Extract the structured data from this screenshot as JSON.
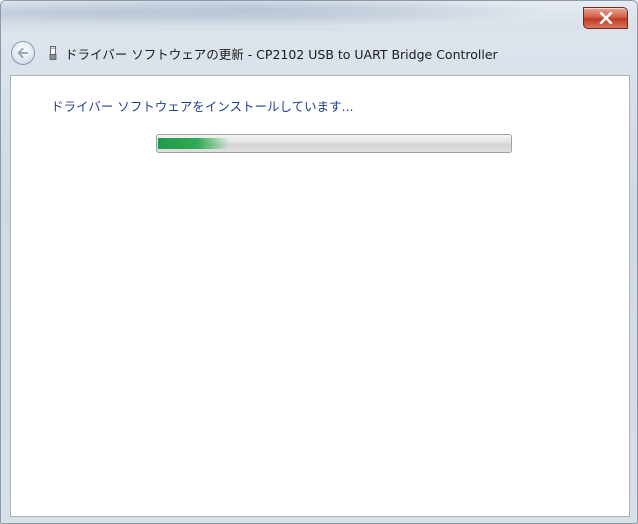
{
  "window": {
    "title": "ドライバー ソフトウェアの更新 - CP2102 USB to UART Bridge Controller"
  },
  "titlebar": {
    "close_icon": "close-icon",
    "back_icon": "back-arrow-icon",
    "driver_icon": "usb-device-icon"
  },
  "content": {
    "status_heading": "ドライバー ソフトウェアをインストールしています...",
    "progress": {
      "value_percent": 20,
      "style": "marquee",
      "color": "#22994a"
    }
  },
  "colors": {
    "heading_text": "#1f3f8f",
    "close_button": "#c0391f"
  }
}
